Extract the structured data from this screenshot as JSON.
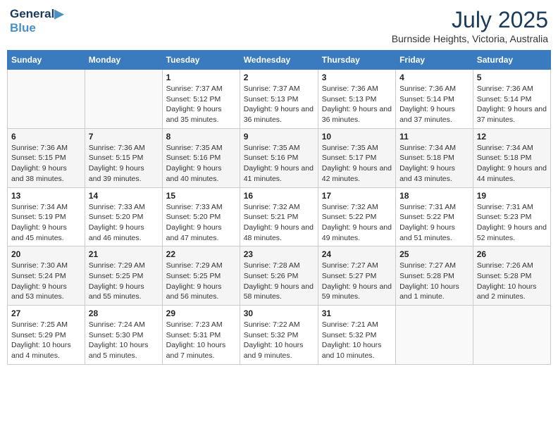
{
  "header": {
    "logo_line1": "General",
    "logo_line2": "Blue",
    "month": "July 2025",
    "location": "Burnside Heights, Victoria, Australia"
  },
  "days_of_week": [
    "Sunday",
    "Monday",
    "Tuesday",
    "Wednesday",
    "Thursday",
    "Friday",
    "Saturday"
  ],
  "weeks": [
    [
      {
        "day": "",
        "detail": ""
      },
      {
        "day": "",
        "detail": ""
      },
      {
        "day": "1",
        "detail": "Sunrise: 7:37 AM\nSunset: 5:12 PM\nDaylight: 9 hours\nand 35 minutes."
      },
      {
        "day": "2",
        "detail": "Sunrise: 7:37 AM\nSunset: 5:13 PM\nDaylight: 9 hours\nand 36 minutes."
      },
      {
        "day": "3",
        "detail": "Sunrise: 7:36 AM\nSunset: 5:13 PM\nDaylight: 9 hours\nand 36 minutes."
      },
      {
        "day": "4",
        "detail": "Sunrise: 7:36 AM\nSunset: 5:14 PM\nDaylight: 9 hours\nand 37 minutes."
      },
      {
        "day": "5",
        "detail": "Sunrise: 7:36 AM\nSunset: 5:14 PM\nDaylight: 9 hours\nand 37 minutes."
      }
    ],
    [
      {
        "day": "6",
        "detail": "Sunrise: 7:36 AM\nSunset: 5:15 PM\nDaylight: 9 hours\nand 38 minutes."
      },
      {
        "day": "7",
        "detail": "Sunrise: 7:36 AM\nSunset: 5:15 PM\nDaylight: 9 hours\nand 39 minutes."
      },
      {
        "day": "8",
        "detail": "Sunrise: 7:35 AM\nSunset: 5:16 PM\nDaylight: 9 hours\nand 40 minutes."
      },
      {
        "day": "9",
        "detail": "Sunrise: 7:35 AM\nSunset: 5:16 PM\nDaylight: 9 hours\nand 41 minutes."
      },
      {
        "day": "10",
        "detail": "Sunrise: 7:35 AM\nSunset: 5:17 PM\nDaylight: 9 hours\nand 42 minutes."
      },
      {
        "day": "11",
        "detail": "Sunrise: 7:34 AM\nSunset: 5:18 PM\nDaylight: 9 hours\nand 43 minutes."
      },
      {
        "day": "12",
        "detail": "Sunrise: 7:34 AM\nSunset: 5:18 PM\nDaylight: 9 hours\nand 44 minutes."
      }
    ],
    [
      {
        "day": "13",
        "detail": "Sunrise: 7:34 AM\nSunset: 5:19 PM\nDaylight: 9 hours\nand 45 minutes."
      },
      {
        "day": "14",
        "detail": "Sunrise: 7:33 AM\nSunset: 5:20 PM\nDaylight: 9 hours\nand 46 minutes."
      },
      {
        "day": "15",
        "detail": "Sunrise: 7:33 AM\nSunset: 5:20 PM\nDaylight: 9 hours\nand 47 minutes."
      },
      {
        "day": "16",
        "detail": "Sunrise: 7:32 AM\nSunset: 5:21 PM\nDaylight: 9 hours\nand 48 minutes."
      },
      {
        "day": "17",
        "detail": "Sunrise: 7:32 AM\nSunset: 5:22 PM\nDaylight: 9 hours\nand 49 minutes."
      },
      {
        "day": "18",
        "detail": "Sunrise: 7:31 AM\nSunset: 5:22 PM\nDaylight: 9 hours\nand 51 minutes."
      },
      {
        "day": "19",
        "detail": "Sunrise: 7:31 AM\nSunset: 5:23 PM\nDaylight: 9 hours\nand 52 minutes."
      }
    ],
    [
      {
        "day": "20",
        "detail": "Sunrise: 7:30 AM\nSunset: 5:24 PM\nDaylight: 9 hours\nand 53 minutes."
      },
      {
        "day": "21",
        "detail": "Sunrise: 7:29 AM\nSunset: 5:25 PM\nDaylight: 9 hours\nand 55 minutes."
      },
      {
        "day": "22",
        "detail": "Sunrise: 7:29 AM\nSunset: 5:25 PM\nDaylight: 9 hours\nand 56 minutes."
      },
      {
        "day": "23",
        "detail": "Sunrise: 7:28 AM\nSunset: 5:26 PM\nDaylight: 9 hours\nand 58 minutes."
      },
      {
        "day": "24",
        "detail": "Sunrise: 7:27 AM\nSunset: 5:27 PM\nDaylight: 9 hours\nand 59 minutes."
      },
      {
        "day": "25",
        "detail": "Sunrise: 7:27 AM\nSunset: 5:28 PM\nDaylight: 10 hours\nand 1 minute."
      },
      {
        "day": "26",
        "detail": "Sunrise: 7:26 AM\nSunset: 5:28 PM\nDaylight: 10 hours\nand 2 minutes."
      }
    ],
    [
      {
        "day": "27",
        "detail": "Sunrise: 7:25 AM\nSunset: 5:29 PM\nDaylight: 10 hours\nand 4 minutes."
      },
      {
        "day": "28",
        "detail": "Sunrise: 7:24 AM\nSunset: 5:30 PM\nDaylight: 10 hours\nand 5 minutes."
      },
      {
        "day": "29",
        "detail": "Sunrise: 7:23 AM\nSunset: 5:31 PM\nDaylight: 10 hours\nand 7 minutes."
      },
      {
        "day": "30",
        "detail": "Sunrise: 7:22 AM\nSunset: 5:32 PM\nDaylight: 10 hours\nand 9 minutes."
      },
      {
        "day": "31",
        "detail": "Sunrise: 7:21 AM\nSunset: 5:32 PM\nDaylight: 10 hours\nand 10 minutes."
      },
      {
        "day": "",
        "detail": ""
      },
      {
        "day": "",
        "detail": ""
      }
    ]
  ]
}
